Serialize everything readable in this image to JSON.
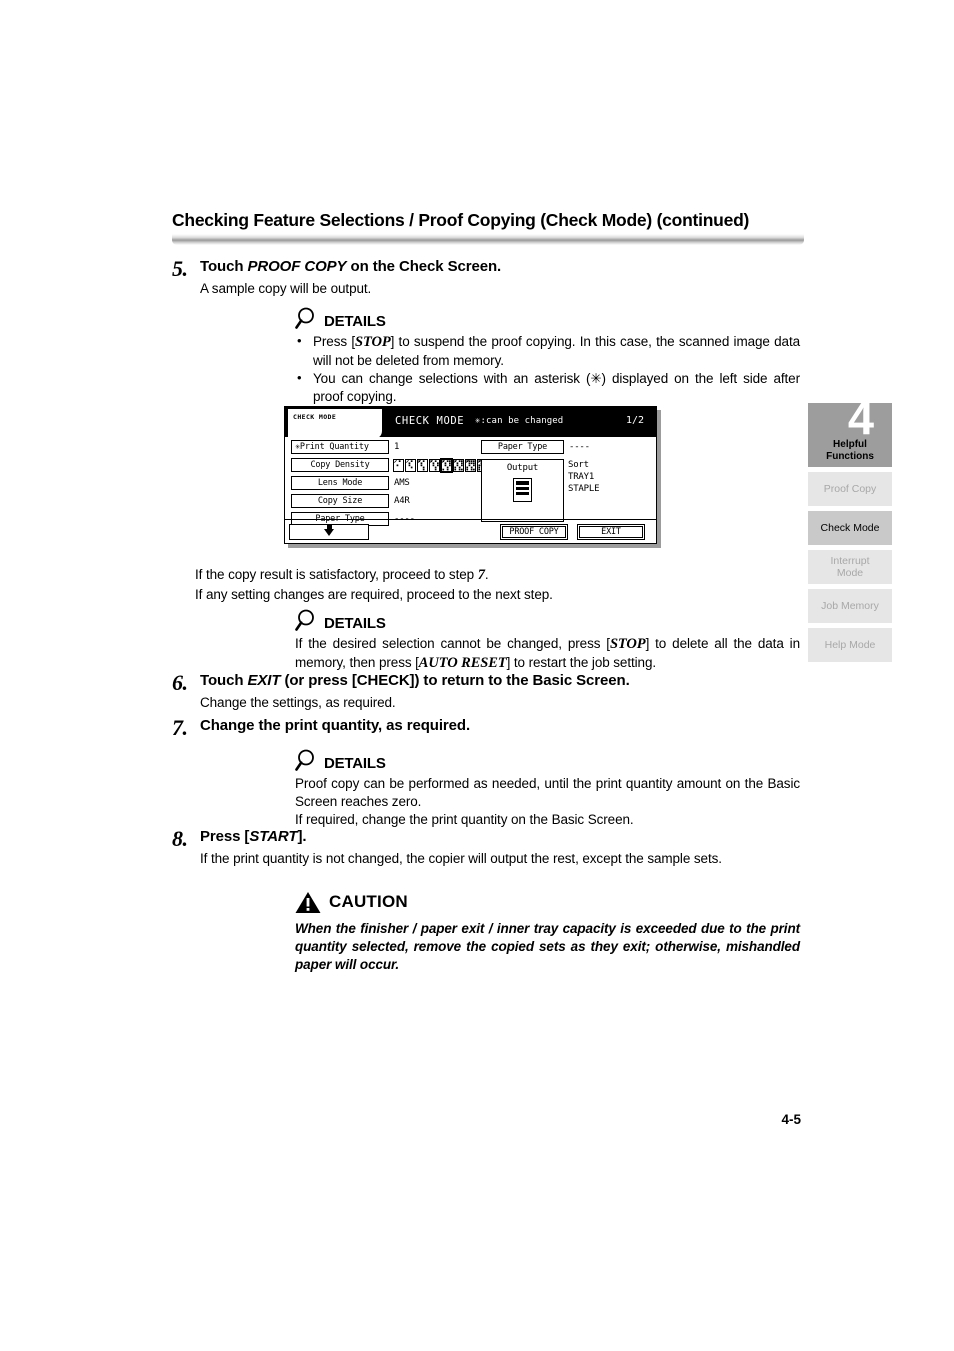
{
  "header": {
    "title": "Checking Feature Selections / Proof Copying (Check Mode) (continued)"
  },
  "steps": [
    {
      "number": "5.",
      "heading_pre": "Touch ",
      "heading_em": "PROOF COPY",
      "heading_post": " on the Check Screen.",
      "sub": "A sample copy will be output."
    },
    {
      "number": "6.",
      "heading_pre": "Touch ",
      "heading_em": "EXIT",
      "heading_post": " (or press [CHECK]) to return to the Basic Screen.",
      "sub": "Change the settings, as required."
    },
    {
      "number": "7.",
      "heading_pre": "",
      "heading_em": "",
      "heading_post": "Change the print quantity, as required.",
      "sub": ""
    },
    {
      "number": "8.",
      "heading_pre": "Press [",
      "heading_em": "START",
      "heading_post": "].",
      "sub": "If the print quantity is not changed, the copier will output the rest, except the sample sets."
    }
  ],
  "details_1": {
    "label": "DETAILS",
    "icon": "magnifier-icon",
    "bullets": [
      {
        "pre": "Press [",
        "em": "STOP",
        "post": "] to suspend the proof copying. In this case, the scanned image data will not be deleted from memory."
      },
      {
        "pre": "",
        "em": "",
        "post": "You can change selections with an asterisk (✳) displayed on the left side after proof copying."
      }
    ]
  },
  "mid_paragraph": {
    "line1_pre": "If the copy result is satisfactory, proceed to step ",
    "line1_em": "7",
    "line1_post": ".",
    "line2": "If any setting changes are required, proceed to the next step."
  },
  "details_2": {
    "label": "DETAILS",
    "icon": "magnifier-icon",
    "text_pre": "If the desired selection cannot be changed, press [",
    "text_em1": "STOP",
    "text_mid": "] to delete all the data in memory, then press [",
    "text_em2": "AUTO RESET",
    "text_post": "] to restart the job setting."
  },
  "details_3": {
    "label": "DETAILS",
    "icon": "magnifier-icon",
    "line1": "Proof copy can be performed as needed, until the print quantity amount on the Basic Screen reaches zero.",
    "line2": "If required, change the print quantity on the Basic Screen."
  },
  "caution": {
    "label": "CAUTION",
    "icon": "warning-triangle-icon",
    "text": "When the finisher / paper exit / inner tray capacity is exceeded due to the print quantity selected, remove the copied sets as they exit; otherwise, mishandled paper will occur."
  },
  "lcd": {
    "tab_label": "CHECK MODE",
    "title": "CHECK MODE",
    "note": "✳:can be changed",
    "page": "1/2",
    "left_fields": [
      {
        "key": "✳Print Quantity",
        "value": "1"
      },
      {
        "key": "Copy Density",
        "value": ""
      },
      {
        "key": "Lens Mode",
        "value": "AMS"
      },
      {
        "key": "Copy Size",
        "value": "A4R"
      },
      {
        "key": "Paper Type",
        "value": "----"
      }
    ],
    "density_levels": 9,
    "density_selected": 5,
    "right_field": {
      "key": "Paper Type",
      "value": "----"
    },
    "output_box": {
      "title": "Output",
      "icon": "output-tray-icon"
    },
    "output_settings": [
      "Sort",
      "TRAY1",
      "STAPLE"
    ],
    "buttons": {
      "scroll_down": "down-arrow-icon",
      "proof_copy": "PROOF COPY",
      "exit": "EXIT"
    }
  },
  "sidebar": {
    "chapter_number": "4",
    "chapter_title_line1": "Helpful",
    "chapter_title_line2": "Functions",
    "items": [
      {
        "label": "Proof Copy",
        "active": false
      },
      {
        "label": "Check Mode",
        "active": true
      },
      {
        "label": "Interrupt\nMode",
        "active": false
      },
      {
        "label": "Job Memory",
        "active": false
      },
      {
        "label": "Help Mode",
        "active": false
      }
    ]
  },
  "footer": {
    "page_number": "4-5"
  },
  "colors": {
    "chapter_tab": "#9d9d9d",
    "active_tab": "#c9c9c9",
    "inactive_tab": "#e6e6e6",
    "inactive_text": "#a8a8a8"
  }
}
